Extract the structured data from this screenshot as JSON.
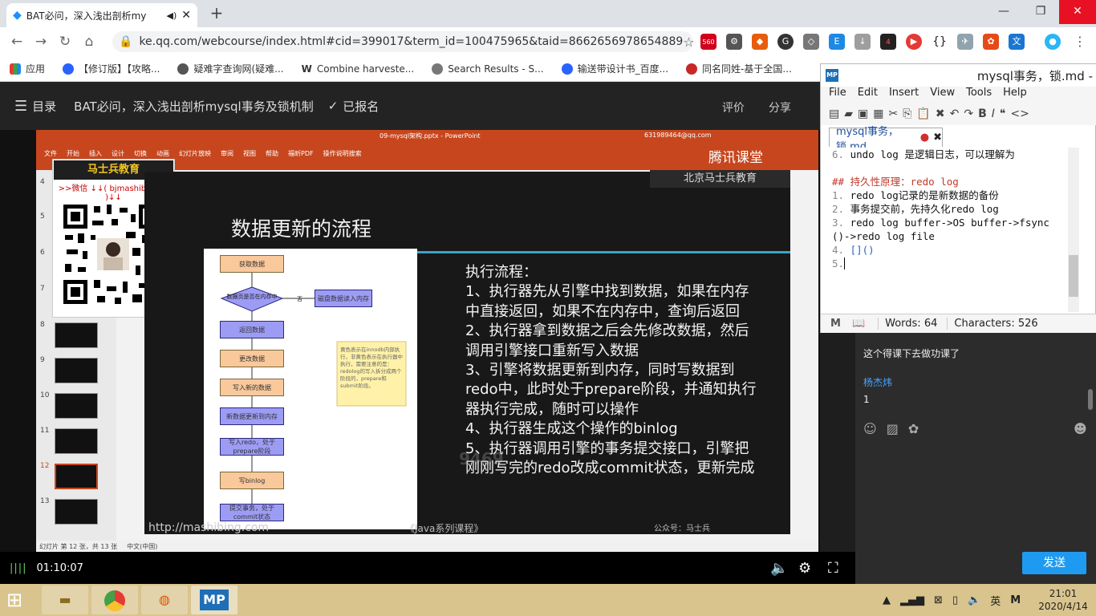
{
  "browser": {
    "tab_title": "BAT必问，深入浅出剖析my",
    "new_tab": "+",
    "url": "ke.qq.com/webcourse/index.html#cid=399017&term_id=100475965&taid=8662656978654889",
    "ext_badge_360": "560",
    "ext_badge_red": "4",
    "bookmarks": [
      "应用",
      "【修订版】【攻略...",
      "疑难字查询网(疑难...",
      "Combine harveste...",
      "Search Results - S...",
      "输送带设计书_百度...",
      "同名同姓-基于全国..."
    ]
  },
  "course": {
    "menu": "目录",
    "title": "BAT必问，深入浅出剖析mysql事务及锁机制",
    "enrolled": "已报名",
    "rate": "评价",
    "share": "分享"
  },
  "ppt": {
    "filename": "09-mysql架构.pptx - PowerPoint",
    "account": "631989464@qq.com",
    "tabs": [
      "文件",
      "开始",
      "插入",
      "设计",
      "切换",
      "动画",
      "幻灯片放映",
      "审阅",
      "视图",
      "帮助",
      "福昕PDF",
      "操作说明搜索"
    ],
    "status": "幻灯片 第 12 张，共 13 张",
    "lang": "中文(中国)",
    "slide_numbers": [
      "4",
      "5",
      "6",
      "7",
      "8",
      "9",
      "10",
      "11",
      "12",
      "13"
    ],
    "tencent": "腾讯课堂"
  },
  "qr": {
    "head": "马士兵教育",
    "sub": ">>微信 ↓↓( bjmashibing02 )↓↓"
  },
  "slide": {
    "brand": "北京马士兵教育",
    "title": "数据更新的流程",
    "flow": [
      "获取数据",
      "数据页是否在内存中",
      "磁盘数据读入内存",
      "返回数据",
      "更改数据",
      "写入新的数据",
      "新数据更新到内存",
      "写入redo，处于prepare阶段",
      "写binlog",
      "提交事务，处于commit状态"
    ],
    "flow_yes": "否",
    "note": "黄色表示在innodb内部执行，非黄色表示在执行器中执行，需要注意的是：redolog的写入拆分成两个阶段的，prepare和submit阶段。",
    "steps": [
      "执行流程：",
      "1、执行器先从引擎中找到数据，如果在内存中直接返回，如果不在内存中，查询后返回",
      "2、执行器拿到数据之后会先修改数据，然后调用引擎接口重新写入数据",
      "3、引擎将数据更新到内存，同时写数据到redo中，此时处于prepare阶段，并通知执行器执行完成，随时可以操作",
      "4、执行器生成这个操作的binlog",
      "5、执行器调用引擎的事务提交接口，引擎把刚刚写完的redo改成commit状态，更新完成"
    ],
    "footer_left": "http://mashibing.com",
    "footer_mid": "《Java系列课程》",
    "footer_right": "公众号：马士兵",
    "watermark": "9469"
  },
  "player": {
    "time": "01:10:07"
  },
  "markdownpad": {
    "title": "mysql事务，锁.md -",
    "menu": [
      "File",
      "Edit",
      "Insert",
      "View",
      "Tools",
      "Help"
    ],
    "tab": "mysql事务，锁.md",
    "lines": [
      {
        "n": "6.",
        "text": "undo log 是逻辑日志，可以理解为"
      },
      {
        "n": "",
        "text": ""
      },
      {
        "n": "##",
        "text": "持久性原理：redo log"
      },
      {
        "n": "1.",
        "text": "redo log记录的是新数据的备份"
      },
      {
        "n": "2.",
        "text": "事务提交前，先持久化redo log"
      },
      {
        "n": "3.",
        "text": "redo log buffer->OS buffer->fsync"
      },
      {
        "n": "",
        "text": "()->redo log file"
      },
      {
        "n": "4.",
        "text": "[]()"
      },
      {
        "n": "5.",
        "text": ""
      }
    ],
    "words": "Words: 64",
    "chars": "Characters: 526"
  },
  "chat": {
    "msg1": "这个得课下去做功课了",
    "user": "杨杰炜",
    "msg2": "1",
    "send": "发送"
  },
  "taskbar": {
    "time": "21:01",
    "date": "2020/4/14",
    "ime": "英",
    "mp": "MP"
  }
}
